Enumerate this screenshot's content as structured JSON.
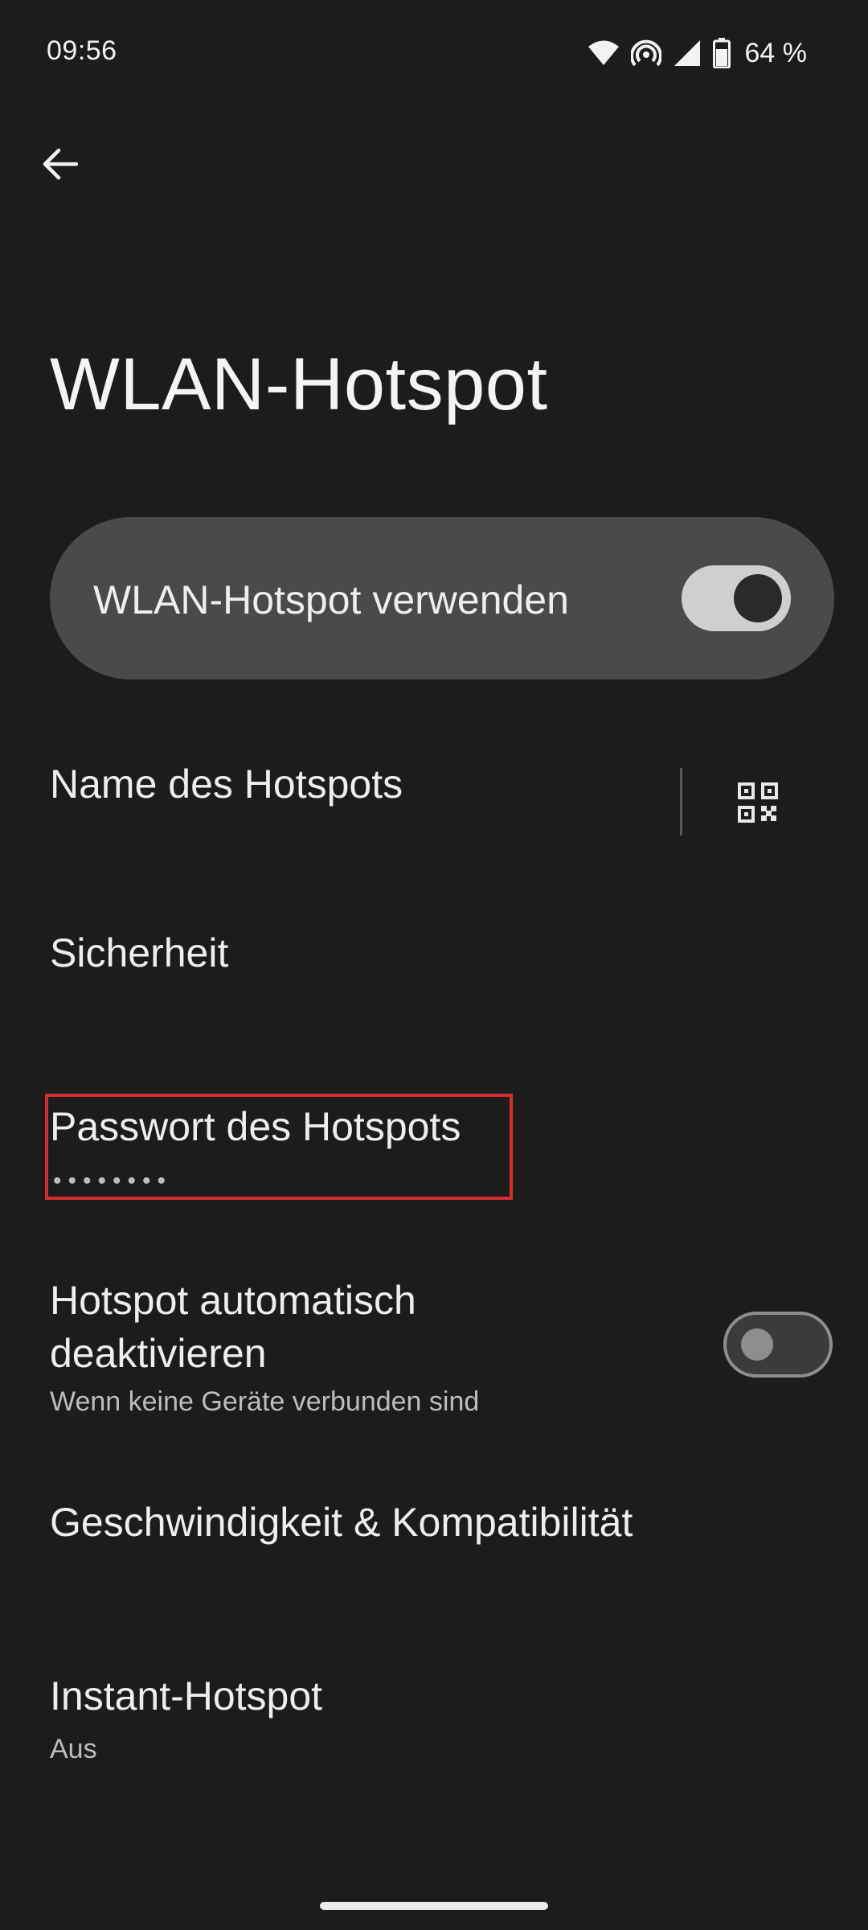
{
  "status_bar": {
    "time": "09:56",
    "battery": "64 %",
    "icons": [
      "wifi-icon",
      "hotspot-icon",
      "signal-icon",
      "battery-icon"
    ]
  },
  "header": {
    "back_icon": "arrow-back-icon",
    "title": "WLAN-Hotspot"
  },
  "master_switch": {
    "label": "WLAN-Hotspot verwenden",
    "enabled": true
  },
  "preferences": {
    "hotspot_name": {
      "title": "Name des Hotspots",
      "share_icon": "qr-code-icon"
    },
    "security": {
      "title": "Sicherheit"
    },
    "password": {
      "title": "Passwort des Hotspots",
      "masked_value": "••••••••"
    },
    "auto_off": {
      "title_line1": "Hotspot automatisch",
      "title_line2": "deaktivieren",
      "summary": "Wenn keine Geräte verbunden sind",
      "enabled": false
    },
    "speed": {
      "title": "Geschwindigkeit & Kompatibilität"
    },
    "instant_hotspot": {
      "title": "Instant-Hotspot",
      "summary": "Aus"
    }
  },
  "colors": {
    "background": "#1c1c1c",
    "card": "#4a4a4a",
    "highlight": "#d32f2f",
    "text_primary": "#eeeeee",
    "text_secondary": "#bdbdbd"
  }
}
